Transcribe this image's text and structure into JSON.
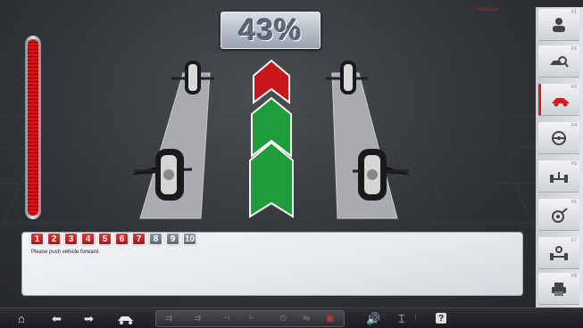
{
  "header": {
    "percent_display": "43%",
    "corner_note": "© Beissbarth"
  },
  "panel": {
    "steps": [
      {
        "num": "1",
        "state": "done"
      },
      {
        "num": "2",
        "state": "done"
      },
      {
        "num": "3",
        "state": "done"
      },
      {
        "num": "4",
        "state": "done"
      },
      {
        "num": "5",
        "state": "done"
      },
      {
        "num": "6",
        "state": "done"
      },
      {
        "num": "7",
        "state": "done"
      },
      {
        "num": "8",
        "state": "todo"
      },
      {
        "num": "9",
        "state": "todo"
      },
      {
        "num": "10",
        "state": "todo"
      }
    ],
    "message": "Please push vehicle forward"
  },
  "sidebar": {
    "items": [
      {
        "key": "F1",
        "icon": "person-icon"
      },
      {
        "key": "F2",
        "icon": "vehicle-search-icon"
      },
      {
        "key": "F3",
        "icon": "car-measure-icon"
      },
      {
        "key": "F4",
        "icon": "steering-wheel-icon"
      },
      {
        "key": "F5",
        "icon": "axle-icon"
      },
      {
        "key": "F6",
        "icon": "wheel-adjust-icon"
      },
      {
        "key": "F7",
        "icon": "axle-adjust-icon"
      },
      {
        "key": "F8",
        "icon": "printer-icon"
      }
    ],
    "active_index": 2,
    "accent": "#d41d1d"
  },
  "toolbar": {
    "items": [
      "home-icon",
      "back-arrow-icon",
      "forward-arrow-icon",
      "car-lift-icon",
      "sound-icon",
      "jack-icon",
      "help-icon"
    ]
  },
  "colors": {
    "arrow_done": "#d0181a",
    "arrow_current": "#1e9d3a",
    "meter": "#d1140f"
  }
}
